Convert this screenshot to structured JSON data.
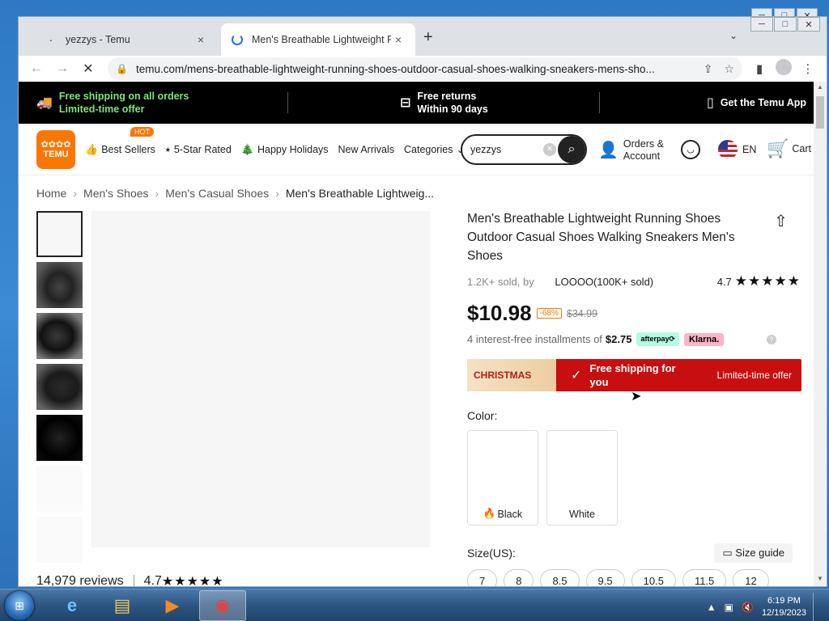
{
  "window_controls": [
    "─",
    "□",
    "✕"
  ],
  "tabs": [
    {
      "title": "yezzys - Temu",
      "close": "×"
    },
    {
      "title": "Men's Breathable Lightweight Ru",
      "close": "×"
    }
  ],
  "new_tab": "+",
  "tab_menu": "⌄",
  "address": {
    "url": "temu.com/mens-breathable-lightweight-running-shoes-outdoor-casual-shoes-walking-sneakers-mens-sho..."
  },
  "promo_bar": {
    "shipping_title": "Free shipping on all orders",
    "shipping_sub": "Limited-time offer",
    "returns_title": "Free returns",
    "returns_sub": "Within 90 days",
    "app": "Get the Temu App"
  },
  "header": {
    "logo_line1": "✿✿✿✿",
    "logo_line2": "TEMU",
    "nav": [
      "Best Sellers",
      "5-Star Rated",
      "Happy Holidays",
      "New Arrivals",
      "Categories"
    ],
    "hot_badge": "HOT",
    "search_value": "yezzys",
    "orders_line1": "Orders &",
    "orders_line2": "Account",
    "lang": "EN",
    "cart": "Cart"
  },
  "breadcrumb": [
    "Home",
    "Men's Shoes",
    "Men's Casual Shoes",
    "Men's Breathable Lightweig..."
  ],
  "reviews": {
    "count": "14,979 reviews",
    "rating": "4.7",
    "stars": "★★★★★"
  },
  "product": {
    "title": "Men's Breathable Lightweight Running Shoes Outdoor Casual Shoes Walking Sneakers Men's Shoes",
    "sold_prefix": "1.2K+ sold, by",
    "seller": "LOOOO(100K+ sold)",
    "rating": "4.7",
    "stars": "★★★★★",
    "price": "$10.98",
    "discount": "-68%",
    "original_price": "$34.99",
    "installments_prefix": "4 interest-free installments of",
    "installment_amount": "$2.75",
    "afterpay": "afterpay⟳",
    "klarna": "Klarna.",
    "banner_christmas": "CHRISTMAS",
    "banner_shipping": "Free shipping for you",
    "banner_offer": "Limited-time offer",
    "color_label": "Color:",
    "colors": [
      "Black",
      "White"
    ],
    "size_label": "Size(US):",
    "size_guide": "Size guide",
    "sizes": [
      "7",
      "8",
      "8.5",
      "9.5",
      "10.5",
      "11.5",
      "12"
    ]
  },
  "taskbar": {
    "time": "6:19 PM",
    "date": "12/19/2023"
  }
}
